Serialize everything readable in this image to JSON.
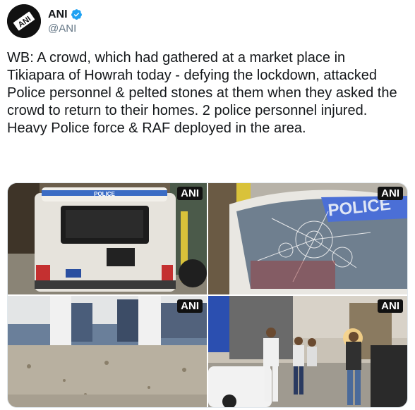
{
  "account": {
    "display_name": "ANI",
    "handle": "@ANI",
    "avatar_text": "ANI",
    "verified_icon": "verified-badge-icon"
  },
  "tweet": {
    "text": "WB: A crowd, which had gathered at a market place in Tikiapara of Howrah today - defying the lockdown, attacked Police personnel & pelted stones at them when they asked the crowd to return to their homes. 2 police personnel injured. Heavy Police force & RAF deployed in the area."
  },
  "media": {
    "photos": [
      {
        "watermark": "ANI",
        "vehicle_label": "POLICE",
        "description": "back of damaged police jeep"
      },
      {
        "watermark": "ANI",
        "vehicle_label": "POLICE",
        "description": "shattered windshield of police vehicle"
      },
      {
        "watermark": "ANI",
        "description": "stone-littered yard with gates"
      },
      {
        "watermark": "ANI",
        "description": "police personnel on street"
      }
    ]
  },
  "colors": {
    "verified": "#1da1f2",
    "handle": "#657786",
    "text": "#14171a"
  }
}
